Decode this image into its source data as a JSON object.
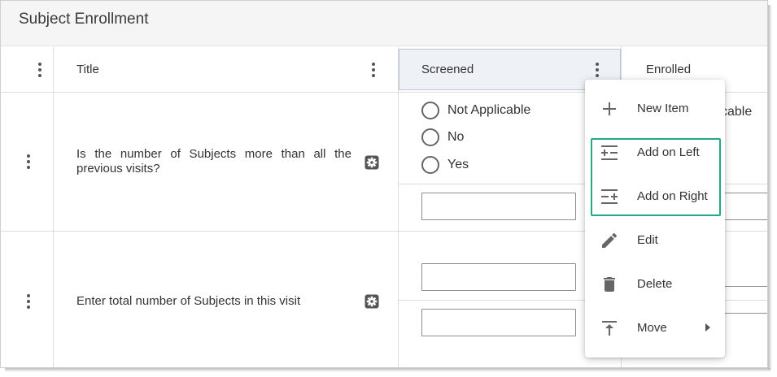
{
  "page": {
    "title": "Subject Enrollment"
  },
  "columns": [
    {
      "label": "Title"
    },
    {
      "label": "Screened"
    },
    {
      "label": "Enrolled"
    }
  ],
  "rows": [
    {
      "question": "Is the number of Subjects more than all the previous visits?",
      "options": [
        "Not Applicable",
        "No",
        "Yes"
      ],
      "enrolled_peek": "cable"
    },
    {
      "question": "Enter total number of Subjects in this visit"
    }
  ],
  "context_menu": {
    "items": [
      {
        "label": "New Item",
        "icon": "plus-icon"
      },
      {
        "label": "Add on Left",
        "icon": "add-column-left-icon"
      },
      {
        "label": "Add on Right",
        "icon": "add-column-right-icon"
      },
      {
        "label": "Edit",
        "icon": "pencil-icon"
      },
      {
        "label": "Delete",
        "icon": "trash-icon"
      },
      {
        "label": "Move",
        "icon": "move-to-top-icon"
      }
    ],
    "highlight_color": "#22a98a"
  }
}
